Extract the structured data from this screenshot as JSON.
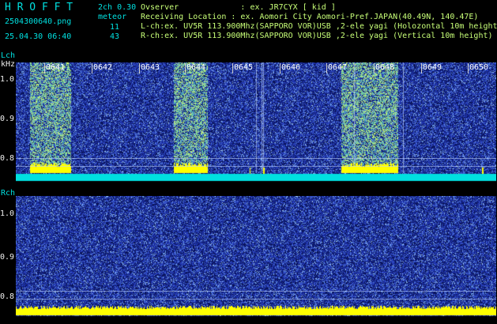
{
  "header": {
    "app_title": "H R O F F T",
    "mode": "2ch 0.30",
    "filename": "2504300640.png",
    "meteor_label": "meteor",
    "meteor_lch": "11",
    "meteor_rch": "43",
    "datetime": "25.04.30 06:40",
    "observer_line": "Ovserver             : ex. JR7CYX [ kid ]",
    "location_line": "Receiving Location : ex. Aomori City Aomori-Pref.JAPAN(40.49N, 140.47E)",
    "lch_line": "L-ch:ex. UV5R 113.900Mhz(SAPPORO VOR)USB ,2-ele yagi (Holozontal 10m height)",
    "rch_line": "R-ch:ex. UV5R 113.900Mhz(SAPPORO VOR)USB ,2-ele yagi (Vertical 10m height)"
  },
  "lch": {
    "label": "Lch",
    "unit": "kHz",
    "y_ticks": [
      "1.0",
      "0.9",
      "0.8"
    ]
  },
  "rch": {
    "label": "Rch",
    "y_ticks": [
      "1.0",
      "0.9",
      "0.8"
    ]
  },
  "time_axis": [
    "0641",
    "0642",
    "0643",
    "0644",
    "0645",
    "0646",
    "0647",
    "0648",
    "0649",
    "0650"
  ],
  "colors": {
    "background": "#000000",
    "noise_base": "#1a2a8c",
    "cyan_band": "#00e0e0",
    "yellow_band": "#ffff00",
    "grid": "#bed2ff"
  }
}
